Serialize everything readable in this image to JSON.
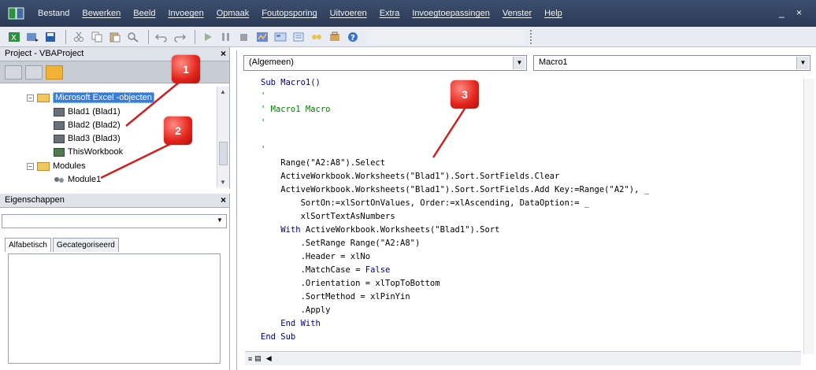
{
  "menubar": {
    "items": [
      "Bestand",
      "Bewerken",
      "Beeld",
      "Invoegen",
      "Opmaak",
      "Foutopsporing",
      "Uitvoeren",
      "Extra",
      "Invoegtoepassingen",
      "Venster",
      "Help"
    ],
    "window_controls": "_ ×"
  },
  "project_panel": {
    "title": "Project - VBAProject",
    "close": "×",
    "tree": {
      "root_label": "Microsoft Excel -objecten",
      "sheets": [
        "Blad1 (Blad1)",
        "Blad2 (Blad2)",
        "Blad3 (Blad3)",
        "ThisWorkbook"
      ],
      "modules_folder": "Modules",
      "module": "Module1"
    }
  },
  "properties_panel": {
    "title": "Eigenschappen",
    "close": "×",
    "tabs": [
      "Alfabetisch",
      "Gecategoriseerd"
    ]
  },
  "code_window": {
    "object_combo": "(Algemeen)",
    "proc_combo": "Macro1",
    "lines": [
      {
        "text": "Sub Macro1()",
        "kind": "kw"
      },
      {
        "text": "'",
        "kind": "cm"
      },
      {
        "text": "' Macro1 Macro",
        "kind": "cm"
      },
      {
        "text": "'",
        "kind": "cm"
      },
      {
        "text": "",
        "kind": "plain"
      },
      {
        "text": "'",
        "kind": "cm"
      },
      {
        "text": "    Range(\"A2:A8\").Select",
        "kind": "plain"
      },
      {
        "text": "    ActiveWorkbook.Worksheets(\"Blad1\").Sort.SortFields.Clear",
        "kind": "plain"
      },
      {
        "text": "    ActiveWorkbook.Worksheets(\"Blad1\").Sort.SortFields.Add Key:=Range(\"A2\"), _",
        "kind": "plain"
      },
      {
        "text": "        SortOn:=xlSortOnValues, Order:=xlAscending, DataOption:= _",
        "kind": "plain"
      },
      {
        "text": "        xlSortTextAsNumbers",
        "kind": "plain"
      },
      {
        "text": "    With ActiveWorkbook.Worksheets(\"Blad1\").Sort",
        "kind": "mixed_with"
      },
      {
        "text": "        .SetRange Range(\"A2:A8\")",
        "kind": "plain"
      },
      {
        "text": "        .Header = xlNo",
        "kind": "plain"
      },
      {
        "text": "        .MatchCase = False",
        "kind": "mixed_false"
      },
      {
        "text": "        .Orientation = xlTopToBottom",
        "kind": "plain"
      },
      {
        "text": "        .SortMethod = xlPinYin",
        "kind": "plain"
      },
      {
        "text": "        .Apply",
        "kind": "plain"
      },
      {
        "text": "    End With",
        "kind": "kw"
      },
      {
        "text": "End Sub",
        "kind": "kw"
      }
    ]
  },
  "callouts": [
    "1",
    "2",
    "3"
  ],
  "colors": {
    "menubar": "#34456a",
    "selection": "#3a7bd5",
    "keyword": "#00007f",
    "comment": "#007f00",
    "callout": "#e2231a"
  }
}
